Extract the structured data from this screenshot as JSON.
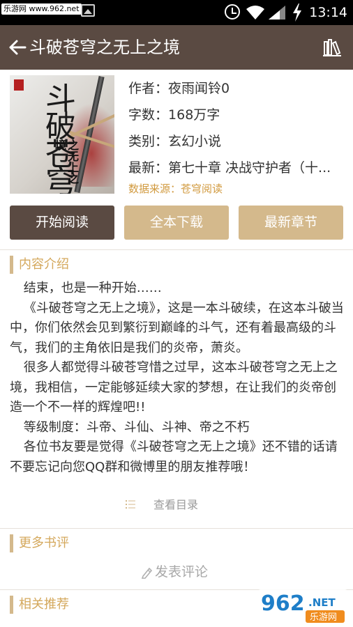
{
  "status_bar": {
    "watermark": "乐游网 www.962.net",
    "time": "13:14"
  },
  "app_bar": {
    "title": "斗破苍穹之无上之境"
  },
  "book": {
    "cover_title": "斗破苍穹",
    "cover_subtitle": "之无上之境",
    "author_label": "作者：",
    "author": "夜雨闻铃0",
    "words_label": "字数：",
    "words": "168万字",
    "category_label": "类别：",
    "category": "玄幻小说",
    "latest_label": "最新：",
    "latest": "第七十章 决战守护者（十...",
    "source_label": "数据来源：",
    "source": "苍穹阅读"
  },
  "actions": {
    "read": "开始阅读",
    "download": "全本下载",
    "latest_chapter": "最新章节"
  },
  "intro": {
    "heading": "内容介绍",
    "paragraphs": [
      "结束，也是一种开始……",
      "《斗破苍穹之无上之境》，这是一本斗破续，在这本斗破当中，你们依然会见到繁衍到巅峰的斗气，还有着最高级的斗气，我们的主角依旧是我们的炎帝，萧炎。",
      "很多人都觉得斗破苍穹惜之过早，这本斗破苍穹之无上之境，我相信，一定能够延续大家的梦想，在让我们的炎帝创造一个不一样的辉煌吧!!",
      "等级制度：斗帝、斗仙、斗神、帝之不朽",
      "各位书友要是觉得《斗破苍穹之无上之境》还不错的话请不要忘记向您QQ群和微博里的朋友推荐哦！"
    ],
    "toc": "查看目录"
  },
  "reviews": {
    "heading": "更多书评",
    "post_comment": "发表评论"
  },
  "recommend": {
    "heading": "相关推荐"
  },
  "logo": {
    "number": "962",
    "domain": ".NET",
    "cn": "乐游网"
  },
  "colors": {
    "app_bar": "#5a4a42",
    "accent": "#d4b98c",
    "source_text": "#d19a3f"
  }
}
